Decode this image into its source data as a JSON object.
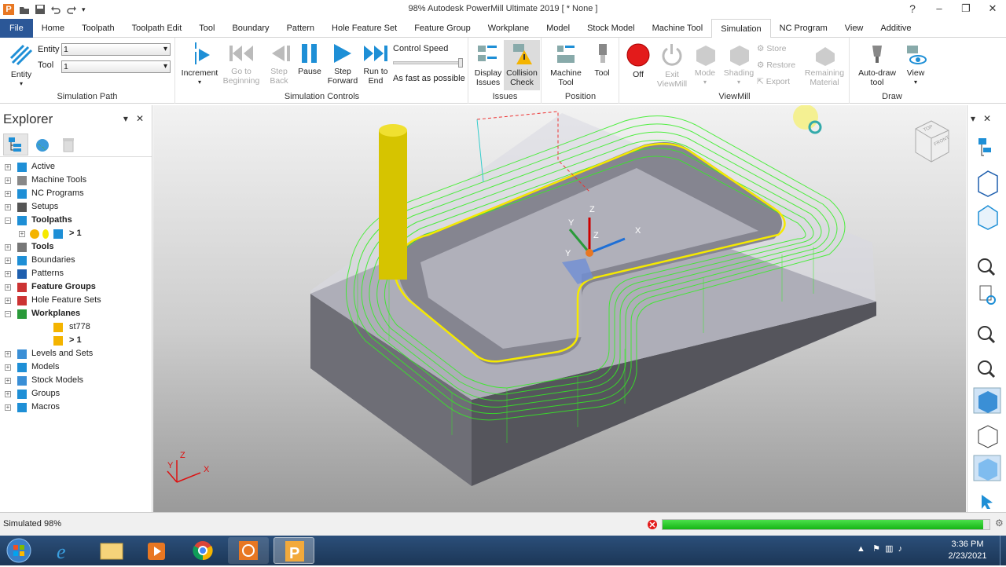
{
  "title_bar": {
    "title": "98% Autodesk PowerMill Ultimate 2019   [ * None ]"
  },
  "menu": {
    "tabs": [
      "File",
      "Home",
      "Toolpath",
      "Toolpath Edit",
      "Tool",
      "Boundary",
      "Pattern",
      "Hole Feature Set",
      "Feature Group",
      "Workplane",
      "Model",
      "Stock Model",
      "Machine Tool",
      "Simulation",
      "NC Program",
      "View",
      "Additive"
    ],
    "active": "Simulation"
  },
  "ribbon": {
    "sim_path": {
      "entity_label": "Entity",
      "entity_field_label": "Entity",
      "entity_value": "1",
      "tool_field_label": "Tool",
      "tool_value": "1",
      "group": "Simulation Path"
    },
    "controls": {
      "increment": "Increment",
      "go_to_beginning": "Go to Beginning",
      "step_back": "Step Back",
      "pause": "Pause",
      "step_forward": "Step Forward",
      "run_to_end": "Run to End",
      "control_speed": "Control Speed",
      "speed_note": "As fast as possible",
      "group": "Simulation Controls"
    },
    "issues": {
      "display_issues": "Display Issues",
      "collision_check": "Collision Check",
      "group": "Issues"
    },
    "position": {
      "machine_tool": "Machine Tool",
      "tool": "Tool",
      "group": "Position"
    },
    "viewmill": {
      "off": "Off",
      "exit_viewmill": "Exit ViewMill",
      "mode": "Mode",
      "shading": "Shading",
      "store": "Store",
      "restore": "Restore",
      "export": "Export",
      "remaining_material": "Remaining Material",
      "group": "ViewMill"
    },
    "draw": {
      "auto_draw_tool": "Auto-draw tool",
      "view": "View",
      "group": "Draw"
    }
  },
  "explorer": {
    "title": "Explorer",
    "items": [
      {
        "label": "Active",
        "bold": false,
        "indent": 0
      },
      {
        "label": "Machine Tools",
        "bold": false,
        "indent": 0
      },
      {
        "label": "NC Programs",
        "bold": false,
        "indent": 0
      },
      {
        "label": "Setups",
        "bold": false,
        "indent": 0
      },
      {
        "label": "Toolpaths",
        "bold": true,
        "indent": 0
      },
      {
        "label": "> 1",
        "bold": true,
        "indent": 1
      },
      {
        "label": "Tools",
        "bold": true,
        "indent": 0
      },
      {
        "label": "Boundaries",
        "bold": false,
        "indent": 0
      },
      {
        "label": "Patterns",
        "bold": false,
        "indent": 0
      },
      {
        "label": "Feature Groups",
        "bold": true,
        "indent": 0
      },
      {
        "label": "Hole Feature Sets",
        "bold": false,
        "indent": 0
      },
      {
        "label": "Workplanes",
        "bold": true,
        "indent": 0
      },
      {
        "label": "st778",
        "bold": false,
        "indent": 2
      },
      {
        "label": "> 1",
        "bold": true,
        "indent": 2
      },
      {
        "label": "Levels and Sets",
        "bold": false,
        "indent": 0
      },
      {
        "label": "Models",
        "bold": false,
        "indent": 0
      },
      {
        "label": "Stock Models",
        "bold": false,
        "indent": 0
      },
      {
        "label": "Groups",
        "bold": false,
        "indent": 0
      },
      {
        "label": "Macros",
        "bold": false,
        "indent": 0
      }
    ]
  },
  "viewport": {
    "axes_labels": {
      "x": "X",
      "y": "Y",
      "z": "Z"
    },
    "viewcube": {
      "top": "TOP",
      "front": "FRONT"
    }
  },
  "status": {
    "text": "Simulated 98%",
    "progress": 0.98
  },
  "taskbar": {
    "time": "3:36 PM",
    "date": "2/23/2021"
  },
  "colors": {
    "accent": "#2b5797",
    "toolpath": "#33ee22",
    "profile": "#f5e900",
    "tool": "#d6c400",
    "progress": "#22cc22"
  }
}
